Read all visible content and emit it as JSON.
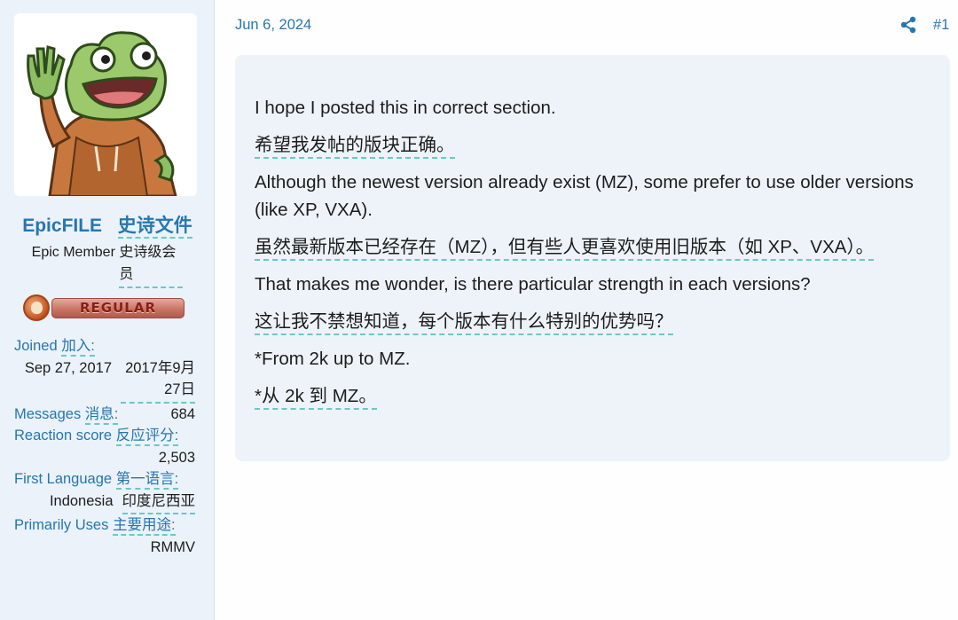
{
  "user": {
    "name": "EpicFILE",
    "name_translation": "史诗文件",
    "title": "Epic Member",
    "title_translation": "史诗级会员",
    "rank_banner": "REGULAR",
    "stats": [
      {
        "label": "Joined",
        "label_translation": "加入:",
        "value": "Sep 27, 2017",
        "value_translation": "2017年9月27日"
      },
      {
        "label": "Messages",
        "label_translation": "消息:",
        "value": "684"
      },
      {
        "label": "Reaction score",
        "label_translation": "反应评分:",
        "value": "2,503"
      },
      {
        "label": "First Language",
        "label_translation": "第一语言:",
        "value": "Indonesia",
        "value_translation": "印度尼西亚"
      },
      {
        "label": "Primarily Uses",
        "label_translation": "主要用途:",
        "value": "RMMV"
      }
    ]
  },
  "post": {
    "date": "Jun 6, 2024",
    "number": "#1",
    "share_icon": "share-icon",
    "lines": [
      {
        "text": "I hope I posted this in correct section.",
        "translated": false
      },
      {
        "text": "希望我发帖的版块正确。",
        "translated": true
      },
      {
        "text": "Although the newest version already exist (MZ), some prefer to use older versions (like XP, VXA).",
        "translated": false
      },
      {
        "text": "虽然最新版本已经存在（MZ），但有些人更喜欢使用旧版本（如 XP、VXA）。",
        "translated": true
      },
      {
        "text": "That makes me wonder, is there particular strength in each versions?",
        "translated": false
      },
      {
        "text": "这让我不禁想知道，每个版本有什么特别的优势吗？",
        "translated": true
      },
      {
        "text": "*From 2k up to MZ.",
        "translated": false
      },
      {
        "text": "*从 2k 到 MZ。",
        "translated": true
      }
    ]
  },
  "colors": {
    "link": "#2577b1",
    "translation_underline": "#6cc7c7",
    "sidebar_bg": "#ebf2fa",
    "post_bg": "#edf3f9"
  }
}
